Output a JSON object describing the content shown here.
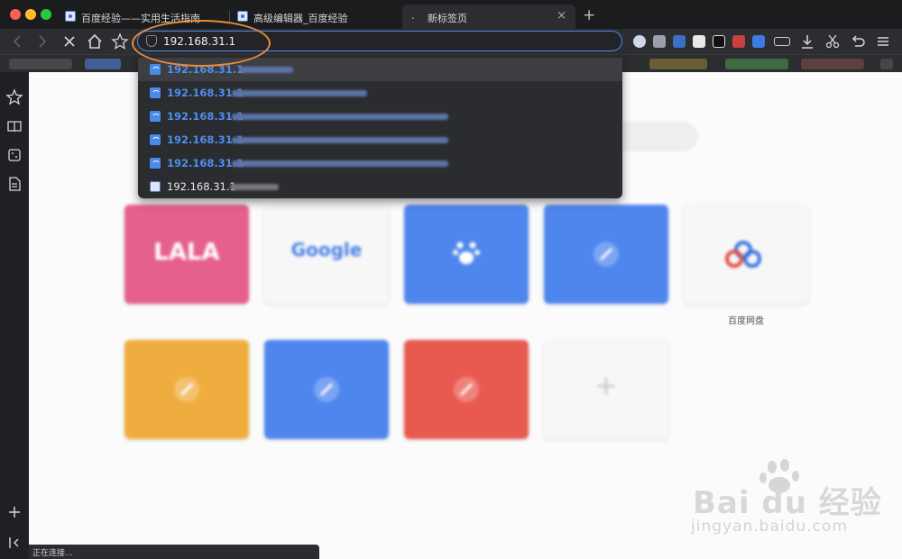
{
  "tabs": [
    {
      "title": "百度经验——实用生活指南",
      "active": false
    },
    {
      "title": "高级编辑器_百度经验",
      "active": false
    },
    {
      "title": "新标签页",
      "active": true,
      "loading_mark": "."
    }
  ],
  "new_tab_symbol": "+",
  "tab_close_symbol": "×",
  "toolbar": {
    "back_icon": "chevron-left-icon",
    "forward_icon": "chevron-right-icon",
    "stop_icon": "x-icon",
    "home_icon": "home-icon",
    "bookmark_icon": "star-icon",
    "url": "192.168.31.1"
  },
  "suggestions": [
    {
      "text": "192.168.31.1",
      "icon": "wifi-icon",
      "selected": true
    },
    {
      "text": "192.168.31.1",
      "icon": "wifi-icon",
      "selected": false
    },
    {
      "text": "192.168.31.1",
      "icon": "wifi-icon",
      "selected": false
    },
    {
      "text": "192.168.31.1",
      "icon": "wifi-icon",
      "selected": false
    },
    {
      "text": "192.168.31.1",
      "icon": "wifi-icon",
      "selected": false
    },
    {
      "text": "192.168.31.1",
      "icon": "baidu-icon",
      "selected": false
    }
  ],
  "tiles": [
    {
      "glyph": "LALA",
      "color": "#e5608a",
      "caption": ""
    },
    {
      "glyph": "Google",
      "color": "#f7f7f7",
      "caption": ""
    },
    {
      "glyph": "paw",
      "color": "#4f86ee",
      "caption": ""
    },
    {
      "glyph": "compass",
      "color": "#4f86ee",
      "caption": ""
    },
    {
      "glyph": "cloud",
      "color": "#f7f7f7",
      "caption": "百度网盘"
    },
    {
      "glyph": "compass",
      "color": "#f0ad3f",
      "caption": ""
    },
    {
      "glyph": "compass",
      "color": "#4f86ee",
      "caption": ""
    },
    {
      "glyph": "compass",
      "color": "#e85a50",
      "caption": ""
    },
    {
      "glyph": "+",
      "color": "#f7f7f7",
      "caption": ""
    }
  ],
  "status": "正在连接...",
  "watermark": {
    "brand": "Bai du 经验",
    "domain": "jingyan.baidu.com"
  },
  "accent_color": "#4f88e6",
  "annotation_color": "#e88a3e"
}
